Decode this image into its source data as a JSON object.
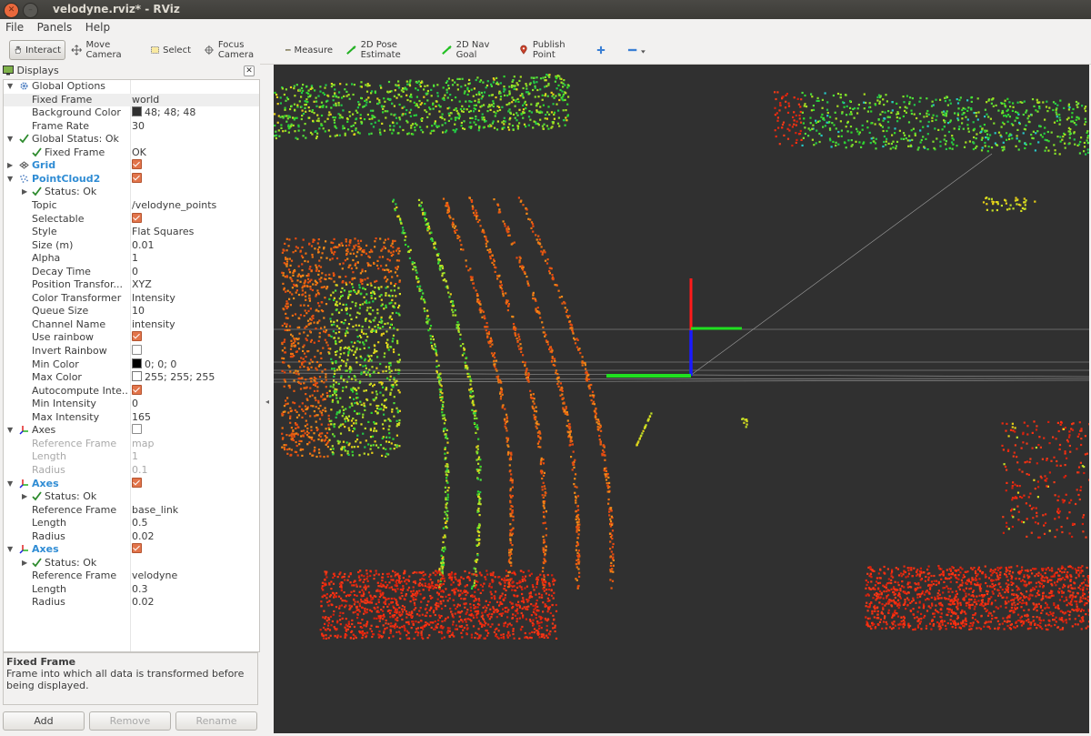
{
  "window": {
    "title": "velodyne.rviz* - RViz"
  },
  "menu": [
    "File",
    "Panels",
    "Help"
  ],
  "toolbar": [
    {
      "label": "Interact",
      "icon": "hand-icon",
      "active": true
    },
    {
      "label": "Move Camera",
      "icon": "move-camera-icon"
    },
    {
      "label": "Select",
      "icon": "select-icon"
    },
    {
      "label": "Focus Camera",
      "icon": "focus-camera-icon"
    },
    {
      "label": "Measure",
      "icon": "ruler-icon"
    },
    {
      "label": "2D Pose Estimate",
      "icon": "pose-estimate-icon"
    },
    {
      "label": "2D Nav Goal",
      "icon": "nav-goal-icon"
    },
    {
      "label": "Publish Point",
      "icon": "publish-point-icon"
    }
  ],
  "displays": {
    "title": "Displays",
    "rows": [
      {
        "level": 0,
        "arrow": "open",
        "icon": "gear-icon",
        "label": "Global Options",
        "value": ""
      },
      {
        "level": 1,
        "label": "Fixed Frame",
        "value": "world",
        "selected": true
      },
      {
        "level": 1,
        "label": "Background Color",
        "value": "48; 48; 48",
        "swatch": "#303030"
      },
      {
        "level": 1,
        "label": "Frame Rate",
        "value": "30"
      },
      {
        "level": 0,
        "arrow": "open",
        "icon": "check-icon",
        "label": "Global Status: Ok",
        "value": ""
      },
      {
        "level": 1,
        "icon": "check-icon",
        "label": "Fixed Frame",
        "value": "OK"
      },
      {
        "level": 0,
        "arrow": "closed",
        "icon": "grid-icon",
        "label": "Grid",
        "value": "",
        "checkbox": true,
        "blue": true
      },
      {
        "level": 0,
        "arrow": "open",
        "icon": "pointcloud-icon",
        "label": "PointCloud2",
        "value": "",
        "checkbox": true,
        "blue": true
      },
      {
        "level": 1,
        "arrow": "closed",
        "icon": "check-icon",
        "label": "Status: Ok",
        "value": ""
      },
      {
        "level": 1,
        "label": "Topic",
        "value": "/velodyne_points"
      },
      {
        "level": 1,
        "label": "Selectable",
        "value": "",
        "checkbox": true
      },
      {
        "level": 1,
        "label": "Style",
        "value": "Flat Squares"
      },
      {
        "level": 1,
        "label": "Size (m)",
        "value": "0.01"
      },
      {
        "level": 1,
        "label": "Alpha",
        "value": "1"
      },
      {
        "level": 1,
        "label": "Decay Time",
        "value": "0"
      },
      {
        "level": 1,
        "label": "Position Transfor...",
        "value": "XYZ"
      },
      {
        "level": 1,
        "label": "Color Transformer",
        "value": "Intensity"
      },
      {
        "level": 1,
        "label": "Queue Size",
        "value": "10"
      },
      {
        "level": 1,
        "label": "Channel Name",
        "value": "intensity"
      },
      {
        "level": 1,
        "label": "Use rainbow",
        "value": "",
        "checkbox": true
      },
      {
        "level": 1,
        "label": "Invert Rainbow",
        "value": "",
        "checkbox": false
      },
      {
        "level": 1,
        "label": "Min Color",
        "value": "0; 0; 0",
        "swatch": "#000000"
      },
      {
        "level": 1,
        "label": "Max Color",
        "value": "255; 255; 255",
        "swatch": "#ffffff"
      },
      {
        "level": 1,
        "label": "Autocompute Inte...",
        "value": "",
        "checkbox": true
      },
      {
        "level": 1,
        "label": "Min Intensity",
        "value": "0"
      },
      {
        "level": 1,
        "label": "Max Intensity",
        "value": "165"
      },
      {
        "level": 0,
        "arrow": "open",
        "icon": "axes-icon",
        "label": "Axes",
        "value": "",
        "checkbox": false
      },
      {
        "level": 1,
        "label": "Reference Frame",
        "value": "map",
        "dim": true
      },
      {
        "level": 1,
        "label": "Length",
        "value": "1",
        "dim": true
      },
      {
        "level": 1,
        "label": "Radius",
        "value": "0.1",
        "dim": true
      },
      {
        "level": 0,
        "arrow": "open",
        "icon": "axes-icon",
        "label": "Axes",
        "value": "",
        "checkbox": true,
        "blue": true
      },
      {
        "level": 1,
        "arrow": "closed",
        "icon": "check-icon",
        "label": "Status: Ok",
        "value": ""
      },
      {
        "level": 1,
        "label": "Reference Frame",
        "value": "base_link"
      },
      {
        "level": 1,
        "label": "Length",
        "value": "0.5"
      },
      {
        "level": 1,
        "label": "Radius",
        "value": "0.02"
      },
      {
        "level": 0,
        "arrow": "open",
        "icon": "axes-icon",
        "label": "Axes",
        "value": "",
        "checkbox": true,
        "blue": true
      },
      {
        "level": 1,
        "arrow": "closed",
        "icon": "check-icon",
        "label": "Status: Ok",
        "value": ""
      },
      {
        "level": 1,
        "label": "Reference Frame",
        "value": "velodyne"
      },
      {
        "level": 1,
        "label": "Length",
        "value": "0.3"
      },
      {
        "level": 1,
        "label": "Radius",
        "value": "0.02"
      }
    ],
    "description": {
      "title": "Fixed Frame",
      "text": "Frame into which all data is transformed before being displayed."
    },
    "buttons": {
      "add": "Add",
      "remove": "Remove",
      "rename": "Rename"
    }
  },
  "viewport": {
    "background": "#303030"
  }
}
